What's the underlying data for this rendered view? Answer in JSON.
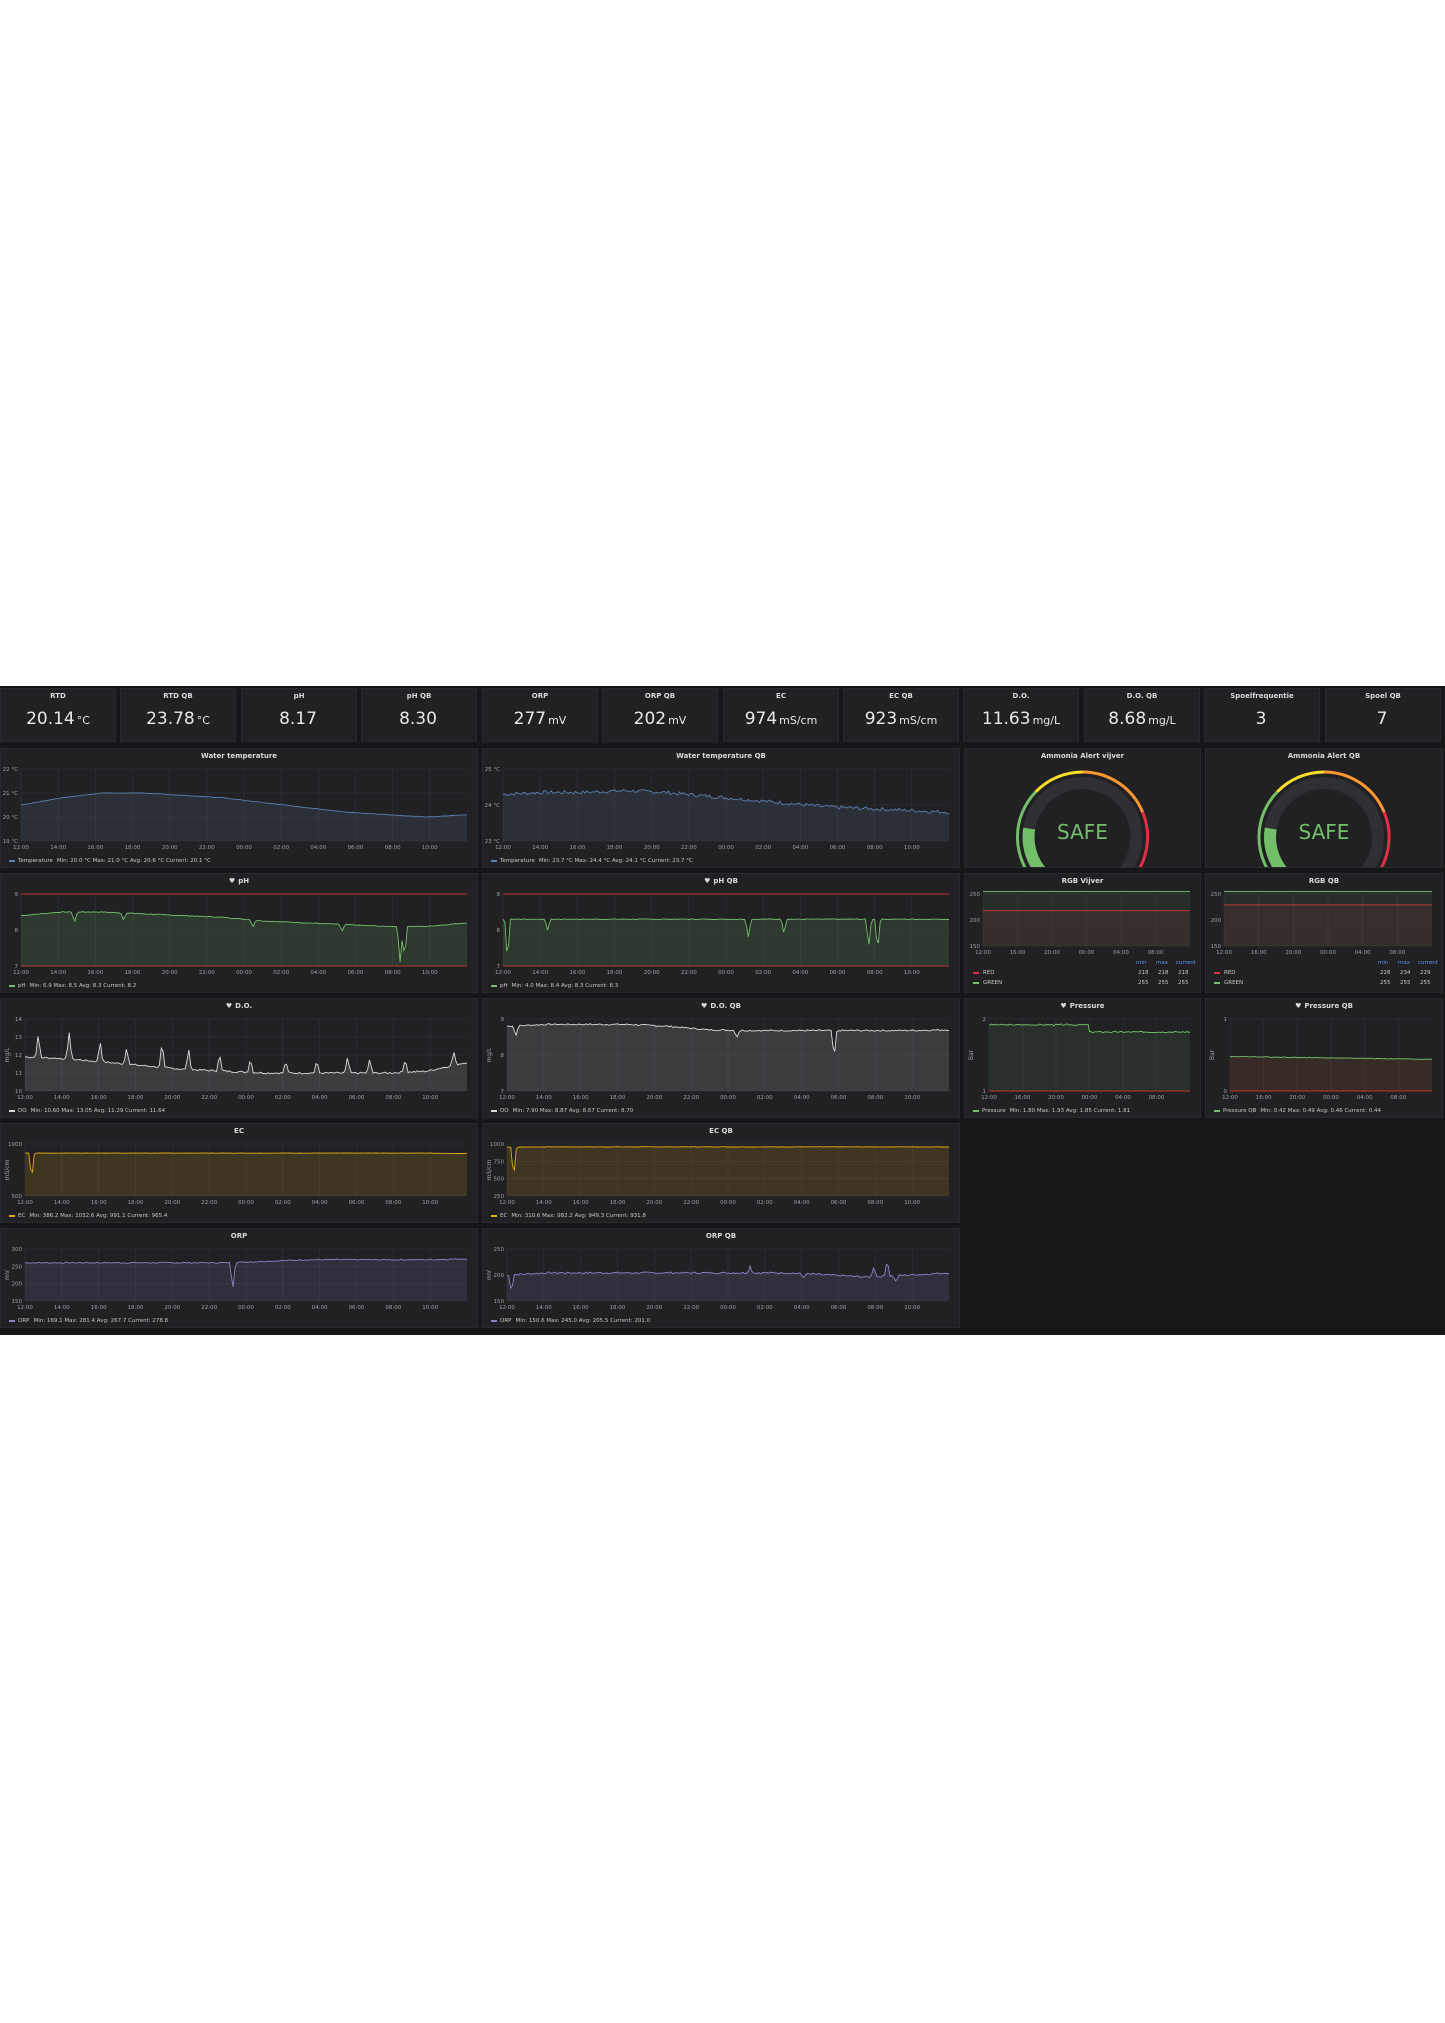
{
  "stats": [
    {
      "title": "RTD",
      "value": "20.14",
      "unit": "°C"
    },
    {
      "title": "RTD QB",
      "value": "23.78",
      "unit": "°C"
    },
    {
      "title": "pH",
      "value": "8.17",
      "unit": ""
    },
    {
      "title": "pH QB",
      "value": "8.30",
      "unit": ""
    },
    {
      "title": "ORP",
      "value": "277",
      "unit": "mV"
    },
    {
      "title": "ORP QB",
      "value": "202",
      "unit": "mV"
    },
    {
      "title": "EC",
      "value": "974",
      "unit": "mS/cm"
    },
    {
      "title": "EC QB",
      "value": "923",
      "unit": "mS/cm"
    },
    {
      "title": "D.O.",
      "value": "11.63",
      "unit": "mg/L"
    },
    {
      "title": "D.O. QB",
      "value": "8.68",
      "unit": "mg/L"
    },
    {
      "title": "Spoelfrequentie",
      "value": "3",
      "unit": ""
    },
    {
      "title": "Spoel QB",
      "value": "7",
      "unit": ""
    }
  ],
  "charts": [
    {
      "title": "Water temperature",
      "heart": false,
      "color": "#5b7fb0",
      "ylabel": "",
      "yticks": [
        "22 °C",
        "21 °C",
        "20 °C",
        "19 °C"
      ],
      "ymin": 19,
      "ymax": 22,
      "xticks": [
        "12:00",
        "14:00",
        "16:00",
        "18:00",
        "20:00",
        "22:00",
        "00:00",
        "02:00",
        "04:00",
        "06:00",
        "08:00",
        "10:00"
      ],
      "series": [
        20.5,
        20.8,
        21.0,
        21.0,
        20.9,
        20.8,
        20.6,
        20.4,
        20.2,
        20.1,
        20.0,
        20.1
      ],
      "spikes": [],
      "noise": 0.01,
      "thresholds": [],
      "legend": {
        "series": "Temperature",
        "stats": "Min: 20.0 °C  Max: 21.0 °C  Avg: 20.6 °C  Current: 20.1 °C"
      }
    },
    {
      "title": "Water temperature QB",
      "heart": false,
      "color": "#5b7fb0",
      "ylabel": "",
      "yticks": [
        "25 °C",
        "24 °C",
        "23 °C"
      ],
      "ymin": 23,
      "ymax": 25,
      "xticks": [
        "12:00",
        "14:00",
        "16:00",
        "18:00",
        "20:00",
        "22:00",
        "00:00",
        "02:00",
        "04:00",
        "06:00",
        "08:00",
        "10:00"
      ],
      "series": [
        24.3,
        24.35,
        24.35,
        24.4,
        24.35,
        24.25,
        24.15,
        24.05,
        23.95,
        23.9,
        23.85,
        23.8
      ],
      "spikes": [],
      "noise": 0.05,
      "thresholds": [],
      "legend": {
        "series": "Temperature",
        "stats": "Min: 23.7 °C  Max: 24.4 °C  Avg: 24.1 °C  Current: 23.7 °C"
      }
    },
    {
      "title": "pH",
      "heart": true,
      "color": "#73bf69",
      "ylabel": "",
      "yticks": [
        "9",
        "8",
        "7"
      ],
      "ymin": 7,
      "ymax": 9,
      "xticks": [
        "12:00",
        "14:00",
        "16:00",
        "18:00",
        "20:00",
        "22:00",
        "00:00",
        "02:00",
        "04:00",
        "06:00",
        "08:00",
        "10:00"
      ],
      "series": [
        8.4,
        8.5,
        8.5,
        8.45,
        8.4,
        8.35,
        8.25,
        8.2,
        8.15,
        8.1,
        8.1,
        8.2
      ],
      "spikes": [
        [
          0.12,
          -0.3
        ],
        [
          0.23,
          -0.2
        ],
        [
          0.52,
          -0.2
        ],
        [
          0.72,
          -0.2
        ],
        [
          0.85,
          -1.0
        ],
        [
          0.86,
          -0.9
        ]
      ],
      "noise": 0.01,
      "thresholds": [
        {
          "value": 9,
          "color": "#c4302b"
        },
        {
          "value": 7,
          "color": "#c4302b"
        }
      ],
      "legend": {
        "series": "pH",
        "stats": "Min: 6.9  Max: 8.5  Avg: 8.3  Current: 8.2"
      }
    },
    {
      "title": "pH QB",
      "heart": true,
      "color": "#73bf69",
      "ylabel": "",
      "yticks": [
        "9",
        "8",
        "7"
      ],
      "ymin": 7,
      "ymax": 9,
      "xticks": [
        "12:00",
        "14:00",
        "16:00",
        "18:00",
        "20:00",
        "22:00",
        "00:00",
        "02:00",
        "04:00",
        "06:00",
        "08:00",
        "10:00"
      ],
      "series": [
        8.3,
        8.3,
        8.3,
        8.3,
        8.3,
        8.3,
        8.3,
        8.3,
        8.3,
        8.3,
        8.3,
        8.3
      ],
      "spikes": [
        [
          0.01,
          -1.2
        ],
        [
          0.1,
          -0.3
        ],
        [
          0.55,
          -0.5
        ],
        [
          0.63,
          -0.4
        ],
        [
          0.82,
          -0.8
        ],
        [
          0.84,
          -0.9
        ]
      ],
      "noise": 0.01,
      "thresholds": [
        {
          "value": 9,
          "color": "#c4302b"
        },
        {
          "value": 7,
          "color": "#c4302b"
        }
      ],
      "legend": {
        "series": "pH",
        "stats": "Min: 4.0  Max: 8.4  Avg: 8.3  Current: 8.3"
      }
    },
    {
      "title": "D.O.",
      "heart": true,
      "color": "#d8d9da",
      "ylabel": "mg/L",
      "yticks": [
        "14",
        "13",
        "12",
        "11",
        "10"
      ],
      "ymin": 10,
      "ymax": 14,
      "xticks": [
        "12:00",
        "14:00",
        "16:00",
        "18:00",
        "20:00",
        "22:00",
        "00:00",
        "02:00",
        "04:00",
        "06:00",
        "08:00",
        "10:00"
      ],
      "series": [
        11.9,
        11.8,
        11.6,
        11.4,
        11.2,
        11.1,
        11.0,
        11.0,
        11.0,
        11.0,
        11.1,
        11.6
      ],
      "spikes": [
        [
          0.03,
          1.3
        ],
        [
          0.1,
          1.5
        ],
        [
          0.17,
          1.2
        ],
        [
          0.23,
          1.0
        ],
        [
          0.31,
          1.4
        ],
        [
          0.37,
          1.2
        ],
        [
          0.44,
          1.0
        ],
        [
          0.51,
          0.8
        ],
        [
          0.59,
          0.7
        ],
        [
          0.66,
          0.7
        ],
        [
          0.73,
          0.9
        ],
        [
          0.78,
          0.8
        ],
        [
          0.86,
          0.8
        ],
        [
          0.97,
          0.8
        ]
      ],
      "noise": 0.05,
      "thresholds": [],
      "legend": {
        "series": "DO",
        "stats": "Min: 10.60  Max: 13.05  Avg: 11.29  Current: 11.64"
      }
    },
    {
      "title": "D.O. QB",
      "heart": true,
      "color": "#d8d9da",
      "ylabel": "mg/L",
      "yticks": [
        "9",
        "8",
        "7"
      ],
      "ymin": 7,
      "ymax": 9,
      "xticks": [
        "12:00",
        "14:00",
        "16:00",
        "18:00",
        "20:00",
        "22:00",
        "00:00",
        "02:00",
        "04:00",
        "06:00",
        "08:00",
        "10:00"
      ],
      "series": [
        8.8,
        8.85,
        8.85,
        8.85,
        8.8,
        8.7,
        8.68,
        8.68,
        8.68,
        8.68,
        8.68,
        8.7
      ],
      "spikes": [
        [
          0.02,
          -0.3
        ],
        [
          0.52,
          -0.2
        ],
        [
          0.74,
          -0.8
        ]
      ],
      "noise": 0.02,
      "thresholds": [],
      "legend": {
        "series": "DO",
        "stats": "Min: 7.90  Max: 8.87  Avg: 8.67  Current: 8.70"
      }
    },
    {
      "title": "EC",
      "heart": false,
      "color": "#e5ac0e",
      "ylabel": "mS/cm",
      "yticks": [
        "1000",
        "500"
      ],
      "ymin": 0,
      "ymax": 1200,
      "xticks": [
        "12:00",
        "14:00",
        "16:00",
        "18:00",
        "20:00",
        "22:00",
        "00:00",
        "02:00",
        "04:00",
        "06:00",
        "08:00",
        "10:00"
      ],
      "series": [
        990,
        990,
        990,
        990,
        990,
        990,
        990,
        990,
        990,
        990,
        990,
        980
      ],
      "spikes": [
        [
          0.015,
          -600
        ]
      ],
      "noise": 3,
      "thresholds": [],
      "legend": {
        "series": "EC",
        "stats": "Min: 386.2  Max: 1032.6  Avg: 991.1  Current: 965.4"
      }
    },
    {
      "title": "EC QB",
      "heart": false,
      "color": "#e5ac0e",
      "ylabel": "mS/cm",
      "yticks": [
        "1000",
        "750",
        "500",
        "250"
      ],
      "ymin": 0,
      "ymax": 1000,
      "xticks": [
        "12:00",
        "14:00",
        "16:00",
        "18:00",
        "20:00",
        "22:00",
        "00:00",
        "02:00",
        "04:00",
        "06:00",
        "08:00",
        "10:00"
      ],
      "series": [
        940,
        945,
        945,
        945,
        945,
        945,
        945,
        945,
        945,
        945,
        945,
        945
      ],
      "spikes": [
        [
          0.015,
          -600
        ]
      ],
      "noise": 4,
      "thresholds": [],
      "legend": {
        "series": "EC",
        "stats": "Min: 310.6  Max: 982.2  Avg: 949.3  Current: 931.8"
      }
    },
    {
      "title": "ORP",
      "heart": false,
      "color": "#8f7fc9",
      "ylabel": "mV",
      "yticks": [
        "300",
        "250",
        "200",
        "150"
      ],
      "ymin": 140,
      "ymax": 310,
      "xticks": [
        "12:00",
        "14:00",
        "16:00",
        "18:00",
        "20:00",
        "22:00",
        "00:00",
        "02:00",
        "04:00",
        "06:00",
        "08:00",
        "10:00"
      ],
      "series": [
        265,
        265,
        265,
        265,
        265,
        265,
        270,
        275,
        275,
        275,
        275,
        278
      ],
      "spikes": [
        [
          0.47,
          -90
        ]
      ],
      "noise": 2,
      "thresholds": [],
      "legend": {
        "series": "ORP",
        "stats": "Min: 169.1  Max: 281.4  Avg: 267.7  Current: 278.8"
      }
    },
    {
      "title": "ORP QB",
      "heart": false,
      "color": "#8f7fc9",
      "ylabel": "mV",
      "yticks": [
        "250",
        "200",
        "150"
      ],
      "ymin": 140,
      "ymax": 260,
      "xticks": [
        "12:00",
        "14:00",
        "16:00",
        "18:00",
        "20:00",
        "22:00",
        "00:00",
        "02:00",
        "04:00",
        "06:00",
        "08:00",
        "10:00"
      ],
      "series": [
        200,
        205,
        205,
        205,
        205,
        205,
        205,
        205,
        200,
        195,
        200,
        205
      ],
      "spikes": [
        [
          0.01,
          -40
        ],
        [
          0.55,
          15
        ],
        [
          0.67,
          -10
        ],
        [
          0.83,
          25
        ],
        [
          0.86,
          40
        ],
        [
          0.88,
          -15
        ]
      ],
      "noise": 2,
      "thresholds": [],
      "legend": {
        "series": "ORP",
        "stats": "Min: 150.6  Max: 245.0  Avg: 205.5  Current: 201.0"
      }
    }
  ],
  "gauges": [
    {
      "title": "Ammonia Alert vijver",
      "text": "SAFE",
      "level": 0.2
    },
    {
      "title": "Ammonia Alert QB",
      "text": "SAFE",
      "level": 0.2
    }
  ],
  "rgb": [
    {
      "title": "RGB Vijver",
      "yticks": [
        "250",
        "200",
        "150"
      ],
      "xticks": [
        "12:00",
        "16:00",
        "20:00",
        "00:00",
        "04:00",
        "08:00"
      ],
      "headers": [
        "min",
        "max",
        "current"
      ],
      "rows": [
        {
          "name": "RED",
          "color": "#e02f44",
          "min": "218",
          "max": "218",
          "current": "218"
        },
        {
          "name": "GREEN",
          "color": "#73bf69",
          "min": "255",
          "max": "255",
          "current": "255"
        }
      ]
    },
    {
      "title": "RGB QB",
      "yticks": [
        "250",
        "200",
        "150"
      ],
      "xticks": [
        "12:00",
        "16:00",
        "20:00",
        "00:00",
        "04:00",
        "08:00"
      ],
      "headers": [
        "min",
        "max",
        "current"
      ],
      "rows": [
        {
          "name": "RED",
          "color": "#e02f44",
          "min": "228",
          "max": "234",
          "current": "229"
        },
        {
          "name": "GREEN",
          "color": "#73bf69",
          "min": "255",
          "max": "255",
          "current": "255"
        }
      ]
    }
  ],
  "pressure": [
    {
      "title": "Pressure",
      "ylabel": "Bar",
      "yticks": [
        "2",
        "1"
      ],
      "ymin": 1,
      "ymax": 2,
      "xticks": [
        "12:00",
        "16:00",
        "20:00",
        "00:00",
        "04:00",
        "08:00"
      ],
      "legend": {
        "series": "Pressure",
        "stats": "Min: 1.80  Max: 1.93  Avg: 1.85  Current: 1.81"
      }
    },
    {
      "title": "Pressure QB",
      "ylabel": "Bar",
      "yticks": [
        "1",
        "0"
      ],
      "ymin": 0,
      "ymax": 1,
      "xticks": [
        "12:00",
        "16:00",
        "20:00",
        "00:00",
        "04:00",
        "08:00"
      ],
      "legend": {
        "series": "Pressure QB",
        "stats": "Min: 0.42  Max: 0.49  Avg: 0.46  Current: 0.44"
      }
    }
  ]
}
